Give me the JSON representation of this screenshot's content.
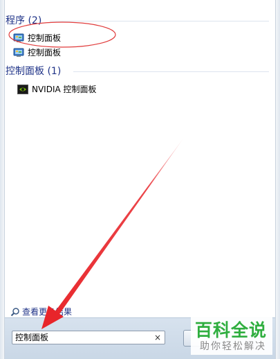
{
  "groups": [
    {
      "header": "程序 (2)",
      "items": [
        {
          "label": "控制面板",
          "icon": "control-panel-icon"
        },
        {
          "label": "控制面板",
          "icon": "control-panel-icon"
        }
      ]
    },
    {
      "header": "控制面板 (1)",
      "items": [
        {
          "label": "NVIDIA 控制面板",
          "icon": "nvidia-icon"
        }
      ]
    }
  ],
  "see_more": {
    "label": "查看更多结果",
    "icon": "search-icon"
  },
  "search": {
    "value": "控制面板",
    "clear_label": "×"
  },
  "watermark": {
    "main": "百科全说",
    "sub": "助你轻松解决"
  },
  "annotations": {
    "ellipse_color": "#e03a3a",
    "arrow_color": "#e8252a"
  },
  "colors": {
    "group_header": "#1e3287",
    "watermark_green": "#2fae3f"
  }
}
